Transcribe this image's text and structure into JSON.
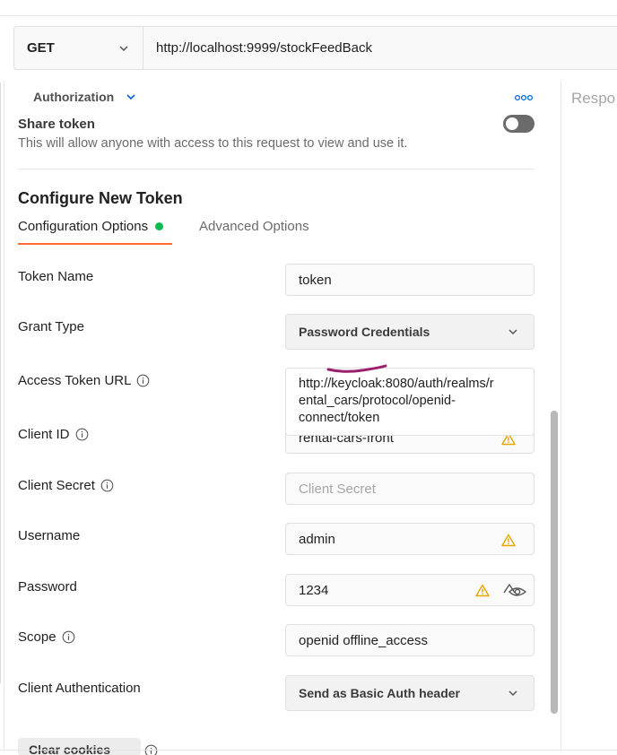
{
  "request": {
    "method": "GET",
    "url": "http://localhost:9999/stockFeedBack"
  },
  "auth": {
    "tab_label": "Authorization"
  },
  "share": {
    "title": "Share token",
    "description": "This will allow anyone with access to this request to view and use it.",
    "enabled": false
  },
  "response_label": "Respo",
  "token_config": {
    "title": "Configure New Token",
    "tabs": [
      {
        "label": "Configuration Options",
        "active": true
      },
      {
        "label": "Advanced Options",
        "active": false
      }
    ],
    "fields": {
      "token_name": {
        "label": "Token Name",
        "value": "token"
      },
      "grant_type": {
        "label": "Grant Type",
        "value": "Password Credentials"
      },
      "access_token_url": {
        "label": "Access Token URL",
        "value": "http://keycloak:8080/auth/realms/rental_cars/protocol/openid-connect/token",
        "lines": [
          "http://keycloak:8080/auth/realms/r",
          "ental_cars/protocol/openid-",
          "connect/token"
        ]
      },
      "client_id": {
        "label": "Client ID",
        "value": "rental-cars-front"
      },
      "client_secret": {
        "label": "Client Secret",
        "placeholder": "Client Secret"
      },
      "username": {
        "label": "Username",
        "value": "admin"
      },
      "password": {
        "label": "Password",
        "value": "1234"
      },
      "scope": {
        "label": "Scope",
        "value": "openid offline_access"
      },
      "client_authentication": {
        "label": "Client Authentication",
        "value": "Send as Basic Auth header"
      }
    }
  },
  "bottom": {
    "clear_cookies_label": "Clear cookies"
  },
  "colors": {
    "accent": "#ff6c37",
    "status_dot": "#0cbb52",
    "warning": "#e8a400",
    "annotation": "#9c1f6e",
    "link_blue": "#0265d2"
  },
  "icons": [
    "chevron-down-icon",
    "more-horizontal-icon",
    "info-icon",
    "warning-icon",
    "eye-icon"
  ]
}
